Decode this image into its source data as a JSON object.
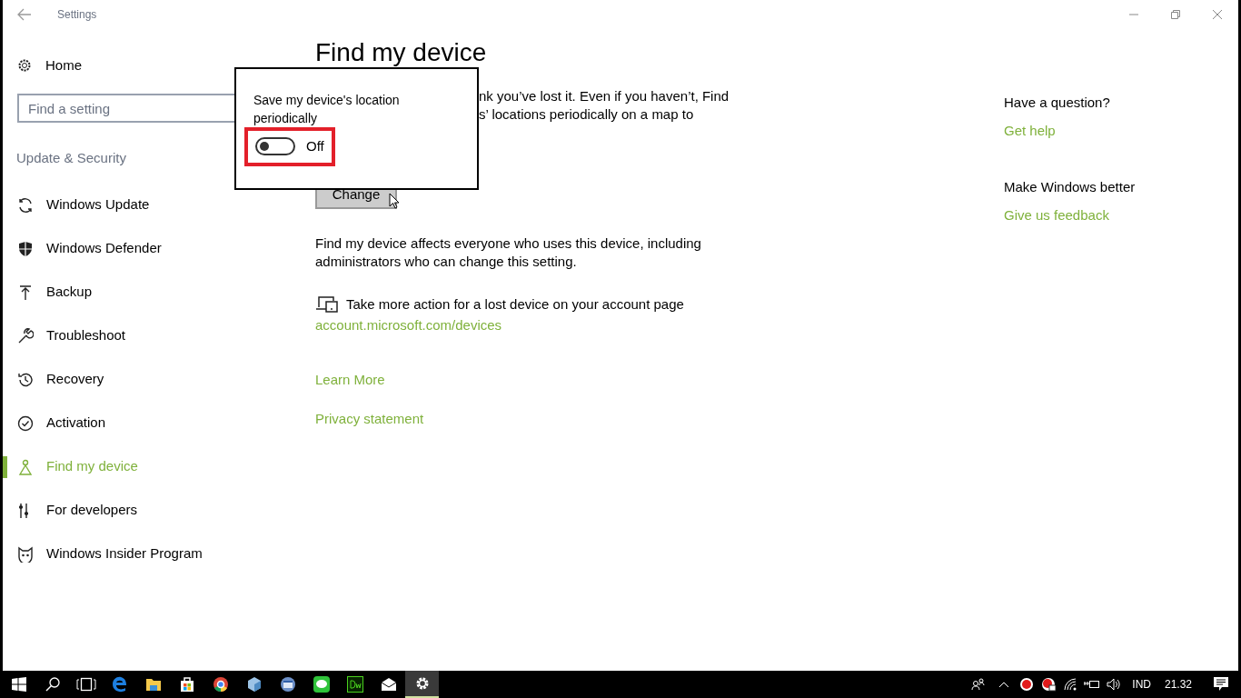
{
  "window": {
    "title": "Settings"
  },
  "sidebar": {
    "home": "Home",
    "search": {
      "placeholder": "Find a setting"
    },
    "section": "Update & Security",
    "items": [
      {
        "label": "Windows Update",
        "selected": false
      },
      {
        "label": "Windows Defender",
        "selected": false
      },
      {
        "label": "Backup",
        "selected": false
      },
      {
        "label": "Troubleshoot",
        "selected": false
      },
      {
        "label": "Recovery",
        "selected": false
      },
      {
        "label": "Activation",
        "selected": false
      },
      {
        "label": "Find my device",
        "selected": true
      },
      {
        "label": "For developers",
        "selected": false
      },
      {
        "label": "Windows Insider Program",
        "selected": false
      }
    ]
  },
  "main": {
    "title": "Find my device",
    "intro_lines": [
      "nk you’ve lost it. Even if you haven’t, Find",
      "s’ locations periodically on a map to"
    ],
    "change_button": "Change",
    "note": "Find my device affects everyone who uses this device, including administrators who can change this setting.",
    "account_text": "Take more action for a lost device on your account page",
    "account_link": "account.microsoft.com/devices",
    "links": [
      "Learn More",
      "Privacy statement"
    ]
  },
  "popup": {
    "label": "Save my device's location periodically",
    "toggle": {
      "on": false,
      "state_text": "Off",
      "highlighted": true
    }
  },
  "help": [
    {
      "heading": "Have a question?",
      "link": "Get help"
    },
    {
      "heading": "Make Windows better",
      "link": "Give us feedback"
    }
  ],
  "taskbar": {
    "apps": [
      {
        "selected": false
      },
      {
        "selected": false
      },
      {
        "selected": false
      },
      {
        "selected": false
      },
      {
        "selected": false
      },
      {
        "selected": false
      },
      {
        "selected": false
      },
      {
        "selected": false
      },
      {
        "selected": false
      },
      {
        "selected": true
      }
    ],
    "language": "IND",
    "time": "21.32"
  }
}
